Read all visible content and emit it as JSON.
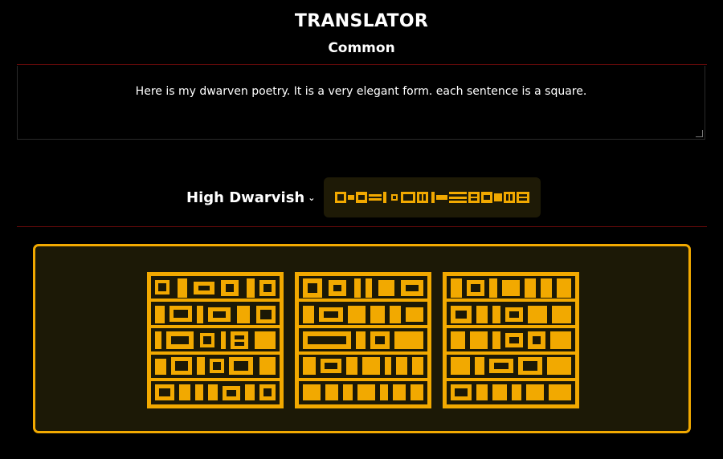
{
  "header": {
    "title": "TRANSLATOR",
    "subtitle": "Common"
  },
  "source": {
    "text": "Here is my dwarven poetry. It is a very elegant form. each sentence is a square."
  },
  "target": {
    "language": "High Dwarvish"
  },
  "colors": {
    "accent": "#f2a900",
    "rule": "#6b0a0a",
    "panel_bg": "#1c1906"
  },
  "icons": {
    "language_dropdown": "chevron-down-icon"
  }
}
